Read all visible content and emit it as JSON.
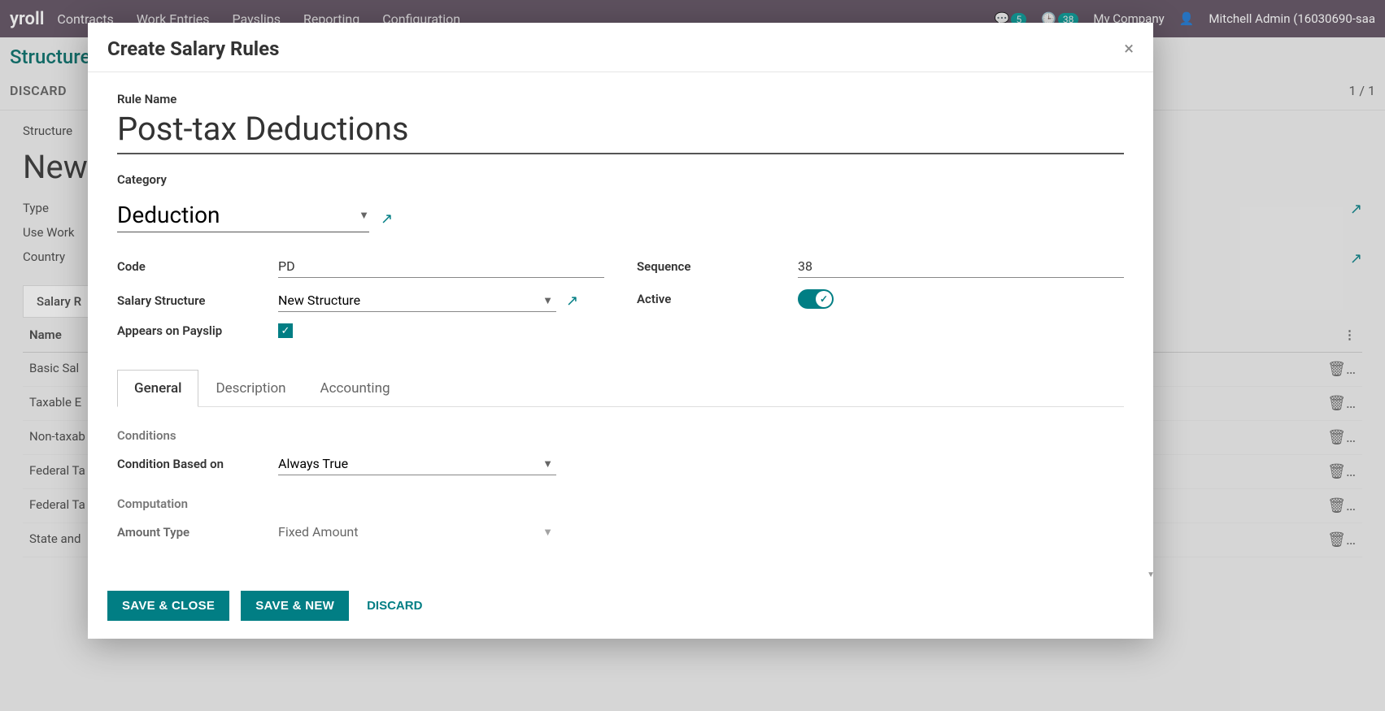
{
  "header": {
    "app_name": "yroll",
    "menu": [
      "Contracts",
      "Work Entries",
      "Payslips",
      "Reporting",
      "Configuration"
    ],
    "badge1": "5",
    "badge2": "38",
    "company": "My Company",
    "user": "Mitchell Admin (16030690-saa"
  },
  "background": {
    "breadcrumb": "Structures",
    "discard": "DISCARD",
    "pager": "1 / 1",
    "structure_label": "Structure",
    "structure_value": "New",
    "type_label": "Type",
    "use_work_label": "Use Work",
    "country_label": "Country",
    "tab": "Salary R",
    "table_header": "Name",
    "rows": [
      "Basic Sal",
      "Taxable E",
      "Non-taxab",
      "Federal Ta",
      "Federal Ta",
      "State and"
    ]
  },
  "modal": {
    "title": "Create Salary Rules",
    "rule_name_label": "Rule Name",
    "rule_name_value": "Post-tax Deductions",
    "category_label": "Category",
    "category_value": "Deduction",
    "fields": {
      "code_label": "Code",
      "code_value": "PD",
      "salary_structure_label": "Salary Structure",
      "salary_structure_value": "New Structure",
      "appears_label": "Appears on Payslip",
      "sequence_label": "Sequence",
      "sequence_value": "38",
      "active_label": "Active"
    },
    "tabs": [
      "General",
      "Description",
      "Accounting"
    ],
    "general": {
      "conditions_title": "Conditions",
      "condition_based_label": "Condition Based on",
      "condition_based_value": "Always True",
      "computation_title": "Computation",
      "amount_type_label": "Amount Type",
      "amount_type_value": "Fixed Amount"
    },
    "footer": {
      "save_close": "SAVE & CLOSE",
      "save_new": "SAVE & NEW",
      "discard": "DISCARD"
    }
  }
}
